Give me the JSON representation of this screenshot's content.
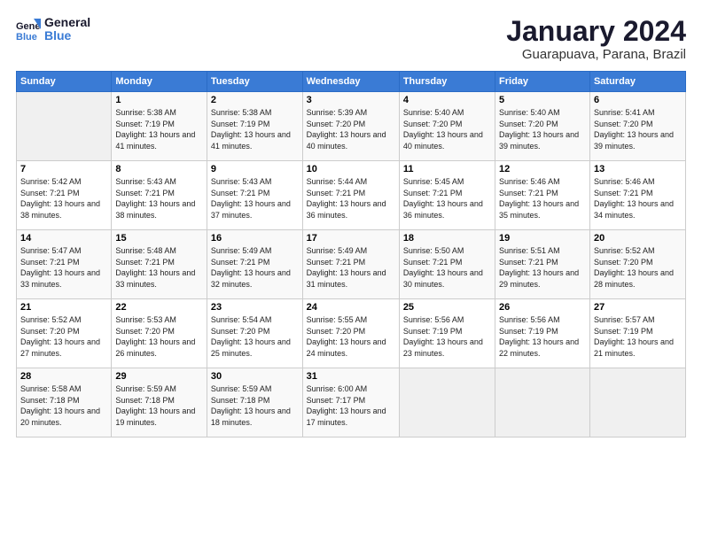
{
  "logo": {
    "line1": "General",
    "line2": "Blue"
  },
  "header": {
    "title": "January 2024",
    "subtitle": "Guarapuava, Parana, Brazil"
  },
  "days_of_week": [
    "Sunday",
    "Monday",
    "Tuesday",
    "Wednesday",
    "Thursday",
    "Friday",
    "Saturday"
  ],
  "weeks": [
    [
      {
        "day": "",
        "sunrise": "",
        "sunset": "",
        "daylight": ""
      },
      {
        "day": "1",
        "sunrise": "Sunrise: 5:38 AM",
        "sunset": "Sunset: 7:19 PM",
        "daylight": "Daylight: 13 hours and 41 minutes."
      },
      {
        "day": "2",
        "sunrise": "Sunrise: 5:38 AM",
        "sunset": "Sunset: 7:19 PM",
        "daylight": "Daylight: 13 hours and 41 minutes."
      },
      {
        "day": "3",
        "sunrise": "Sunrise: 5:39 AM",
        "sunset": "Sunset: 7:20 PM",
        "daylight": "Daylight: 13 hours and 40 minutes."
      },
      {
        "day": "4",
        "sunrise": "Sunrise: 5:40 AM",
        "sunset": "Sunset: 7:20 PM",
        "daylight": "Daylight: 13 hours and 40 minutes."
      },
      {
        "day": "5",
        "sunrise": "Sunrise: 5:40 AM",
        "sunset": "Sunset: 7:20 PM",
        "daylight": "Daylight: 13 hours and 39 minutes."
      },
      {
        "day": "6",
        "sunrise": "Sunrise: 5:41 AM",
        "sunset": "Sunset: 7:20 PM",
        "daylight": "Daylight: 13 hours and 39 minutes."
      }
    ],
    [
      {
        "day": "7",
        "sunrise": "Sunrise: 5:42 AM",
        "sunset": "Sunset: 7:21 PM",
        "daylight": "Daylight: 13 hours and 38 minutes."
      },
      {
        "day": "8",
        "sunrise": "Sunrise: 5:43 AM",
        "sunset": "Sunset: 7:21 PM",
        "daylight": "Daylight: 13 hours and 38 minutes."
      },
      {
        "day": "9",
        "sunrise": "Sunrise: 5:43 AM",
        "sunset": "Sunset: 7:21 PM",
        "daylight": "Daylight: 13 hours and 37 minutes."
      },
      {
        "day": "10",
        "sunrise": "Sunrise: 5:44 AM",
        "sunset": "Sunset: 7:21 PM",
        "daylight": "Daylight: 13 hours and 36 minutes."
      },
      {
        "day": "11",
        "sunrise": "Sunrise: 5:45 AM",
        "sunset": "Sunset: 7:21 PM",
        "daylight": "Daylight: 13 hours and 36 minutes."
      },
      {
        "day": "12",
        "sunrise": "Sunrise: 5:46 AM",
        "sunset": "Sunset: 7:21 PM",
        "daylight": "Daylight: 13 hours and 35 minutes."
      },
      {
        "day": "13",
        "sunrise": "Sunrise: 5:46 AM",
        "sunset": "Sunset: 7:21 PM",
        "daylight": "Daylight: 13 hours and 34 minutes."
      }
    ],
    [
      {
        "day": "14",
        "sunrise": "Sunrise: 5:47 AM",
        "sunset": "Sunset: 7:21 PM",
        "daylight": "Daylight: 13 hours and 33 minutes."
      },
      {
        "day": "15",
        "sunrise": "Sunrise: 5:48 AM",
        "sunset": "Sunset: 7:21 PM",
        "daylight": "Daylight: 13 hours and 33 minutes."
      },
      {
        "day": "16",
        "sunrise": "Sunrise: 5:49 AM",
        "sunset": "Sunset: 7:21 PM",
        "daylight": "Daylight: 13 hours and 32 minutes."
      },
      {
        "day": "17",
        "sunrise": "Sunrise: 5:49 AM",
        "sunset": "Sunset: 7:21 PM",
        "daylight": "Daylight: 13 hours and 31 minutes."
      },
      {
        "day": "18",
        "sunrise": "Sunrise: 5:50 AM",
        "sunset": "Sunset: 7:21 PM",
        "daylight": "Daylight: 13 hours and 30 minutes."
      },
      {
        "day": "19",
        "sunrise": "Sunrise: 5:51 AM",
        "sunset": "Sunset: 7:21 PM",
        "daylight": "Daylight: 13 hours and 29 minutes."
      },
      {
        "day": "20",
        "sunrise": "Sunrise: 5:52 AM",
        "sunset": "Sunset: 7:20 PM",
        "daylight": "Daylight: 13 hours and 28 minutes."
      }
    ],
    [
      {
        "day": "21",
        "sunrise": "Sunrise: 5:52 AM",
        "sunset": "Sunset: 7:20 PM",
        "daylight": "Daylight: 13 hours and 27 minutes."
      },
      {
        "day": "22",
        "sunrise": "Sunrise: 5:53 AM",
        "sunset": "Sunset: 7:20 PM",
        "daylight": "Daylight: 13 hours and 26 minutes."
      },
      {
        "day": "23",
        "sunrise": "Sunrise: 5:54 AM",
        "sunset": "Sunset: 7:20 PM",
        "daylight": "Daylight: 13 hours and 25 minutes."
      },
      {
        "day": "24",
        "sunrise": "Sunrise: 5:55 AM",
        "sunset": "Sunset: 7:20 PM",
        "daylight": "Daylight: 13 hours and 24 minutes."
      },
      {
        "day": "25",
        "sunrise": "Sunrise: 5:56 AM",
        "sunset": "Sunset: 7:19 PM",
        "daylight": "Daylight: 13 hours and 23 minutes."
      },
      {
        "day": "26",
        "sunrise": "Sunrise: 5:56 AM",
        "sunset": "Sunset: 7:19 PM",
        "daylight": "Daylight: 13 hours and 22 minutes."
      },
      {
        "day": "27",
        "sunrise": "Sunrise: 5:57 AM",
        "sunset": "Sunset: 7:19 PM",
        "daylight": "Daylight: 13 hours and 21 minutes."
      }
    ],
    [
      {
        "day": "28",
        "sunrise": "Sunrise: 5:58 AM",
        "sunset": "Sunset: 7:18 PM",
        "daylight": "Daylight: 13 hours and 20 minutes."
      },
      {
        "day": "29",
        "sunrise": "Sunrise: 5:59 AM",
        "sunset": "Sunset: 7:18 PM",
        "daylight": "Daylight: 13 hours and 19 minutes."
      },
      {
        "day": "30",
        "sunrise": "Sunrise: 5:59 AM",
        "sunset": "Sunset: 7:18 PM",
        "daylight": "Daylight: 13 hours and 18 minutes."
      },
      {
        "day": "31",
        "sunrise": "Sunrise: 6:00 AM",
        "sunset": "Sunset: 7:17 PM",
        "daylight": "Daylight: 13 hours and 17 minutes."
      },
      {
        "day": "",
        "sunrise": "",
        "sunset": "",
        "daylight": ""
      },
      {
        "day": "",
        "sunrise": "",
        "sunset": "",
        "daylight": ""
      },
      {
        "day": "",
        "sunrise": "",
        "sunset": "",
        "daylight": ""
      }
    ]
  ]
}
